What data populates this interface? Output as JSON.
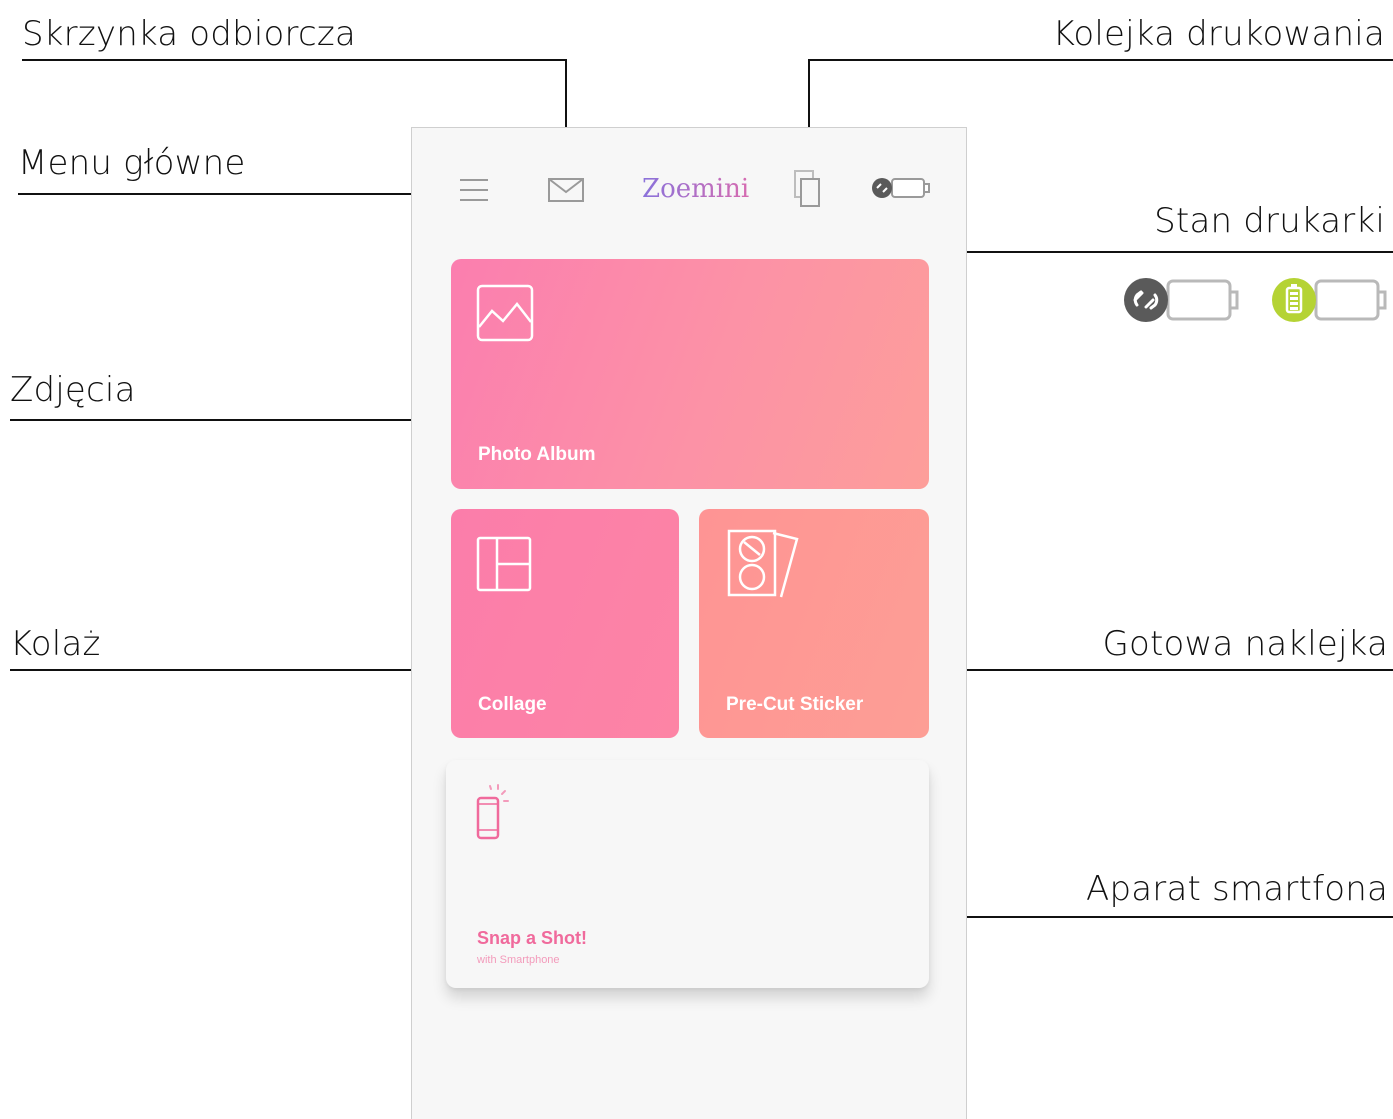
{
  "annotations": {
    "inbox": "Skrzynka odbiorcza",
    "print_queue": "Kolejka drukowania",
    "main_menu": "Menu główne",
    "printer_status": "Stan drukarki",
    "photos": "Zdjęcia",
    "collage": "Kolaż",
    "sticker": "Gotowa naklejka",
    "camera": "Aparat smartfona"
  },
  "app": {
    "logo": "Zoemini",
    "cards": {
      "photo_album": "Photo Album",
      "collage": "Collage",
      "sticker": "Pre-Cut Sticker",
      "snap_title": "Snap a Shot!",
      "snap_subtitle": "with Smartphone"
    }
  },
  "icons": {
    "menu": "hamburger-icon",
    "inbox": "envelope-icon",
    "queue": "print-queue-icon",
    "status": "printer-status-icon",
    "photo": "image-icon",
    "collage": "collage-layout-icon",
    "sticker": "sticker-sheet-icon",
    "phone": "smartphone-icon",
    "disconnected": "disconnected-printer-icon",
    "battery": "battery-printer-icon"
  },
  "colors": {
    "card_photo": "#fc8aa9",
    "card_collage": "#fc80a8",
    "card_sticker": "#fe9895",
    "snap_text": "#f06a9c",
    "battery_green": "#b5d334",
    "status_gray": "#5a5a5a"
  }
}
